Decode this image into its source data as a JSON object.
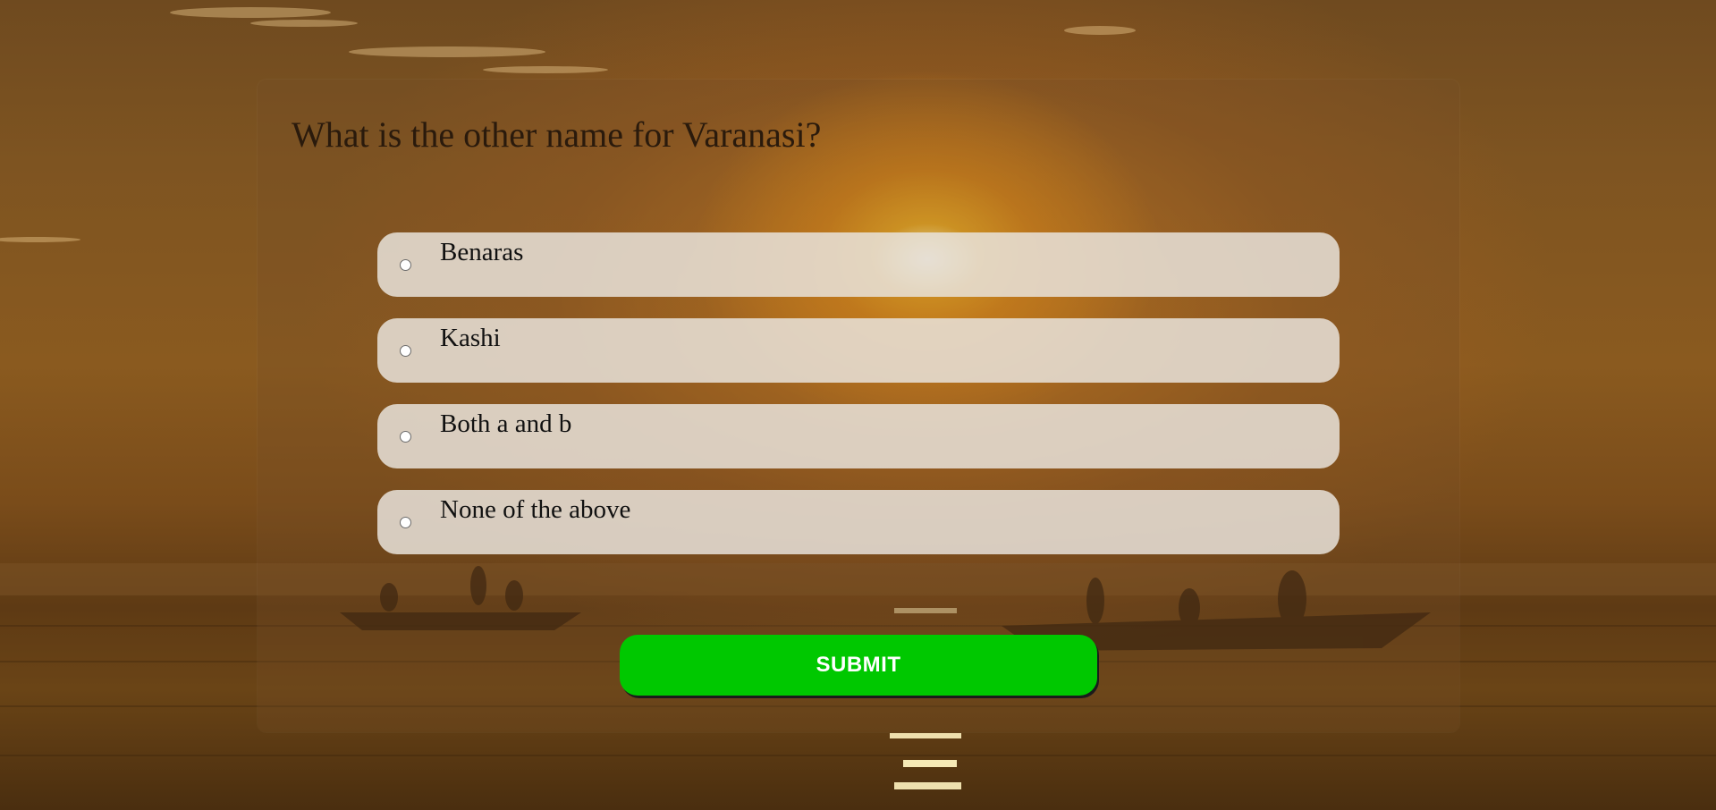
{
  "quiz": {
    "question": "What is the other name for Varanasi?",
    "options": [
      {
        "label": "Benaras",
        "selected": false
      },
      {
        "label": "Kashi",
        "selected": false
      },
      {
        "label": "Both a and b",
        "selected": false
      },
      {
        "label": "None of the above",
        "selected": false
      }
    ],
    "submit_label": "SUBMIT"
  },
  "colors": {
    "submit_button": "#00c800",
    "option_background": "#e8e2da",
    "question_text": "#2a1a0c"
  },
  "background": {
    "scene": "sunset-over-river-with-boats"
  }
}
